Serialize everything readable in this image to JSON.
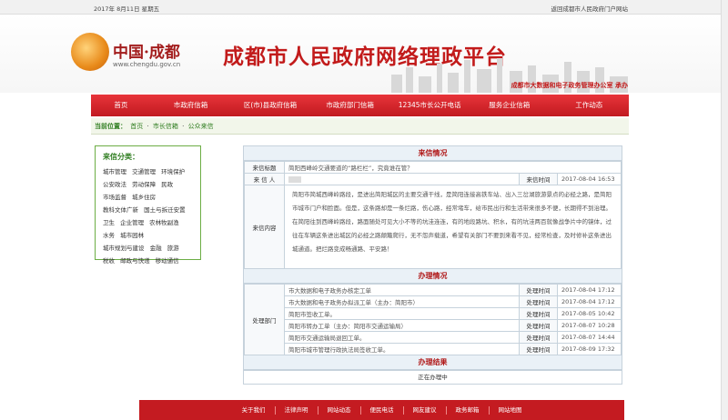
{
  "topbar": {
    "date": "2017年 8月11日 星期五",
    "portal_link": "返回成都市人民政府门户网站"
  },
  "logo": {
    "name": "中国·成都",
    "url": "www.chengdu.gov.cn"
  },
  "site_title": "成都市人民政府网络理政平台",
  "sponsor": "成都市大数据和电子政务管理办公室 承办",
  "nav": [
    "首页",
    "市政府信箱",
    "区(市)县政府信箱",
    "市政府部门信箱",
    "12345市长公开电话",
    "服务企业信箱",
    "工作动态"
  ],
  "breadcrumb": {
    "label": "当前位置：",
    "items": [
      "首页",
      "市长信箱",
      "公众来信"
    ]
  },
  "categories": {
    "title": "来信分类：",
    "items": [
      "城市管理",
      "交通管理",
      "环境保护",
      "公安政法",
      "劳动保障",
      "民政",
      "市场监督",
      "城乡住房",
      "教科文体广新",
      "国土与拆迁安置",
      "卫生",
      "企业管理",
      "农林牧副渔",
      "水务",
      "城市园林",
      "城市规划与建设",
      "金融",
      "旅游",
      "税收",
      "邮政与快递",
      "移动通信"
    ]
  },
  "letter": {
    "section_title": "来信情况",
    "subject_label": "来信标题",
    "subject": "简阳西峰岭交通要道的“路栏栏”，究竟谁在管？",
    "sender_label": "来 信 人",
    "sender": "",
    "time_label": "来信时间",
    "time": "2017-08-04 16:53",
    "content_label": "来信内容",
    "content": "简阳市简城西峰岭路段，是进出简阳城区的主要交通干线，是简阳连接高铁车站、出入三岔湖旅游景点的必经之路，是简阳市城市门户和脸面。但是，这条路却是一条烂路，伤心路，经常堵车，给市民出行和生活带来很多不便，长期得不到治理。 在简阳往到西峰岭路段，路面随处可见大小不等的坑洼连连，有的地段路坑、积水，有的坑洼两百就像战争片中的镜体，过往在车辆这条进出城区的必经之路颠簸爬行，无不怨声载道，希望有关部门不要到来看不见，经常检查，及时修补这条进出城通道。把烂路变成畅通路、平安路！"
  },
  "handling": {
    "section_title": "办理情况",
    "dept_label": "处理部门",
    "time_label": "处理时间",
    "rows": [
      {
        "text": "市大数据和电子政务办核定工单",
        "time": "2017-08-04 17:12"
      },
      {
        "text": "市大数据和电子政务办拟派工单（主办：简阳市）",
        "time": "2017-08-04 17:12"
      },
      {
        "text": "简阳市签收工单。",
        "time": "2017-08-05 10:42"
      },
      {
        "text": "简阳市转办工单（主办：简阳市交通运输局）",
        "time": "2017-08-07 10:28"
      },
      {
        "text": "简阳市交通运输局退回工单。",
        "time": "2017-08-07 14:44"
      },
      {
        "text": "简阳市城市管理行政执法局签收工单。",
        "time": "2017-08-09 17:32"
      }
    ]
  },
  "result": {
    "section_title": "办理结果",
    "status": "正在办理中"
  },
  "footer": [
    "关于我们",
    "法律声明",
    "网站动态",
    "便民电话",
    "网友建议",
    "政务邮箱",
    "网站地图"
  ]
}
